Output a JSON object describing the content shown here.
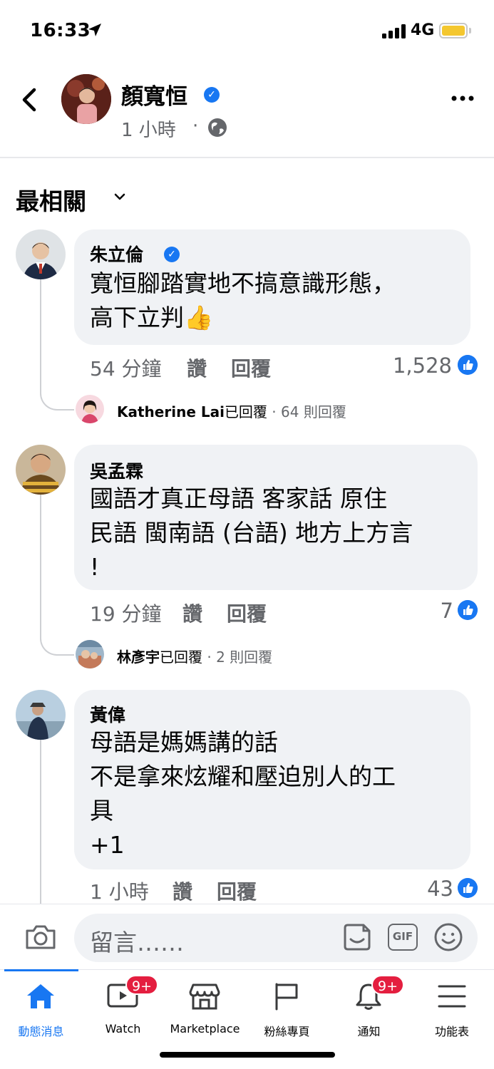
{
  "status_bar": {
    "time": "16:33",
    "network": "4G"
  },
  "post_header": {
    "author": "顏寬恒",
    "time": "1 小時",
    "separator": "·"
  },
  "sort": {
    "label": "最相關"
  },
  "comments": [
    {
      "name": "朱立倫",
      "verified": true,
      "lines": [
        "寬恒腳踏實地不搞意識形態，",
        "高下立判👍"
      ],
      "time": "54 分鐘",
      "like": "讚",
      "reply": "回覆",
      "reactions": "1,528",
      "replies_preview": {
        "name": "Katherine Lai",
        "action": "已回覆",
        "count": " · 64 則回覆"
      }
    },
    {
      "name": "吳孟霖",
      "verified": false,
      "lines": [
        "國語才真正母語 客家話 原住",
        "民語 閩南語 (台語) 地方上方言",
        "!"
      ],
      "time": "19 分鐘",
      "like": "讚",
      "reply": "回覆",
      "reactions": "7",
      "replies_preview": {
        "name": "林彥宇",
        "action": "已回覆",
        "count": " · 2 則回覆"
      }
    },
    {
      "name": "黃偉",
      "verified": false,
      "lines": [
        "母語是媽媽講的話",
        "不是拿來炫耀和壓迫別人的工",
        "具",
        "+1"
      ],
      "time": "1 小時",
      "like": "讚",
      "reply": "回覆",
      "reactions": "43"
    }
  ],
  "composer": {
    "placeholder": "留言……",
    "gif_label": "GIF"
  },
  "tab_bar": {
    "tabs": [
      {
        "label": "動態消息",
        "active": true
      },
      {
        "label": "Watch",
        "badge": "9+"
      },
      {
        "label": "Marketplace"
      },
      {
        "label": "粉絲專頁"
      },
      {
        "label": "通知",
        "badge": "9+"
      },
      {
        "label": "功能表"
      }
    ]
  },
  "colors": {
    "accent": "#1877f2",
    "badge": "#e41e3f",
    "bubble": "#f0f2f5",
    "secondary_text": "#65676b"
  }
}
